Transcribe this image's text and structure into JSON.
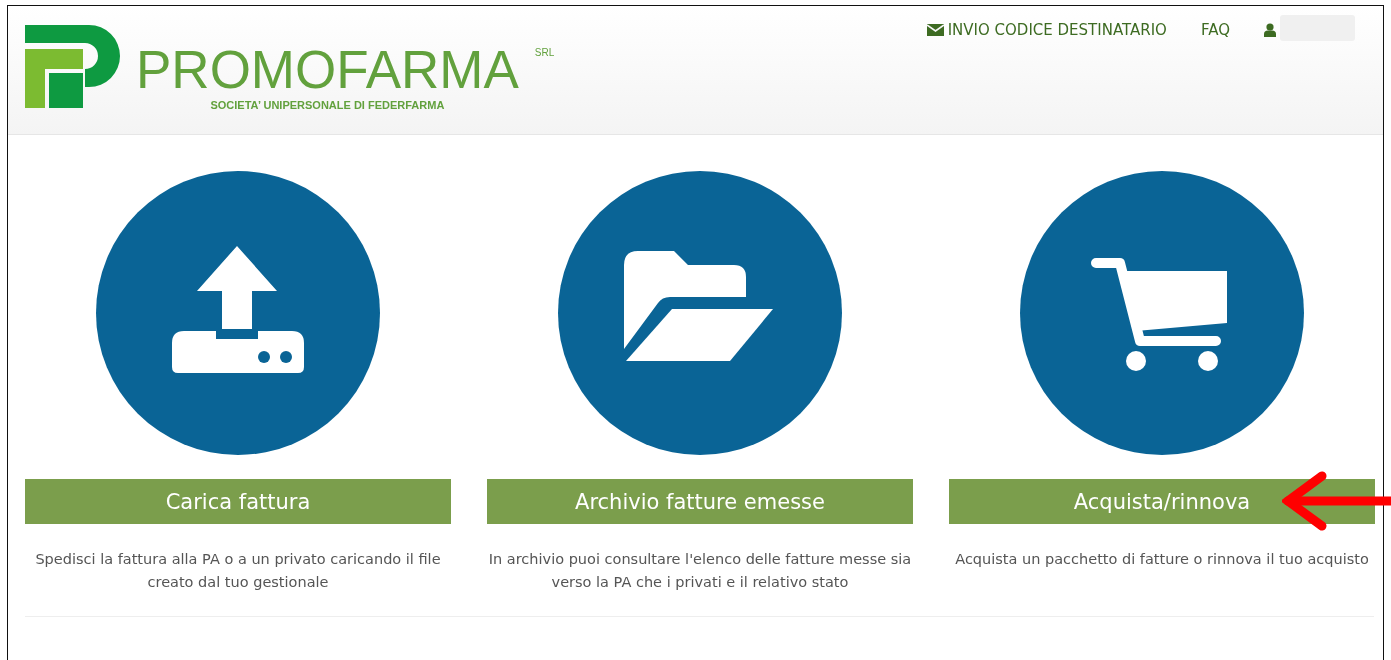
{
  "header": {
    "logo": {
      "name": "PROMOFARMA",
      "suffix": "SRL",
      "tagline": "SOCIETA’ UNIPERSONALE DI FEDERFARMA"
    },
    "nav": [
      {
        "kind": "mail-link",
        "label": "INVIO CODICE DESTINATARIO"
      },
      {
        "kind": "link",
        "label": "FAQ"
      },
      {
        "kind": "user",
        "redacted": true
      }
    ]
  },
  "cards": [
    {
      "kind": "upload",
      "title": "Carica fattura",
      "description": "Spedisci la fattura alla PA o a un privato caricando il file creato dal tuo gestionale",
      "highlighted": false
    },
    {
      "kind": "folder",
      "title": "Archivio fatture emesse",
      "description": "In archivio puoi consultare l'elenco delle fatture messe sia verso la PA che i privati e il relativo stato",
      "highlighted": false
    },
    {
      "kind": "cart",
      "title": "Acquista/rinnova",
      "description": "Acquista un pacchetto di fatture o rinnova il tuo acquisto",
      "highlighted": true
    }
  ]
}
